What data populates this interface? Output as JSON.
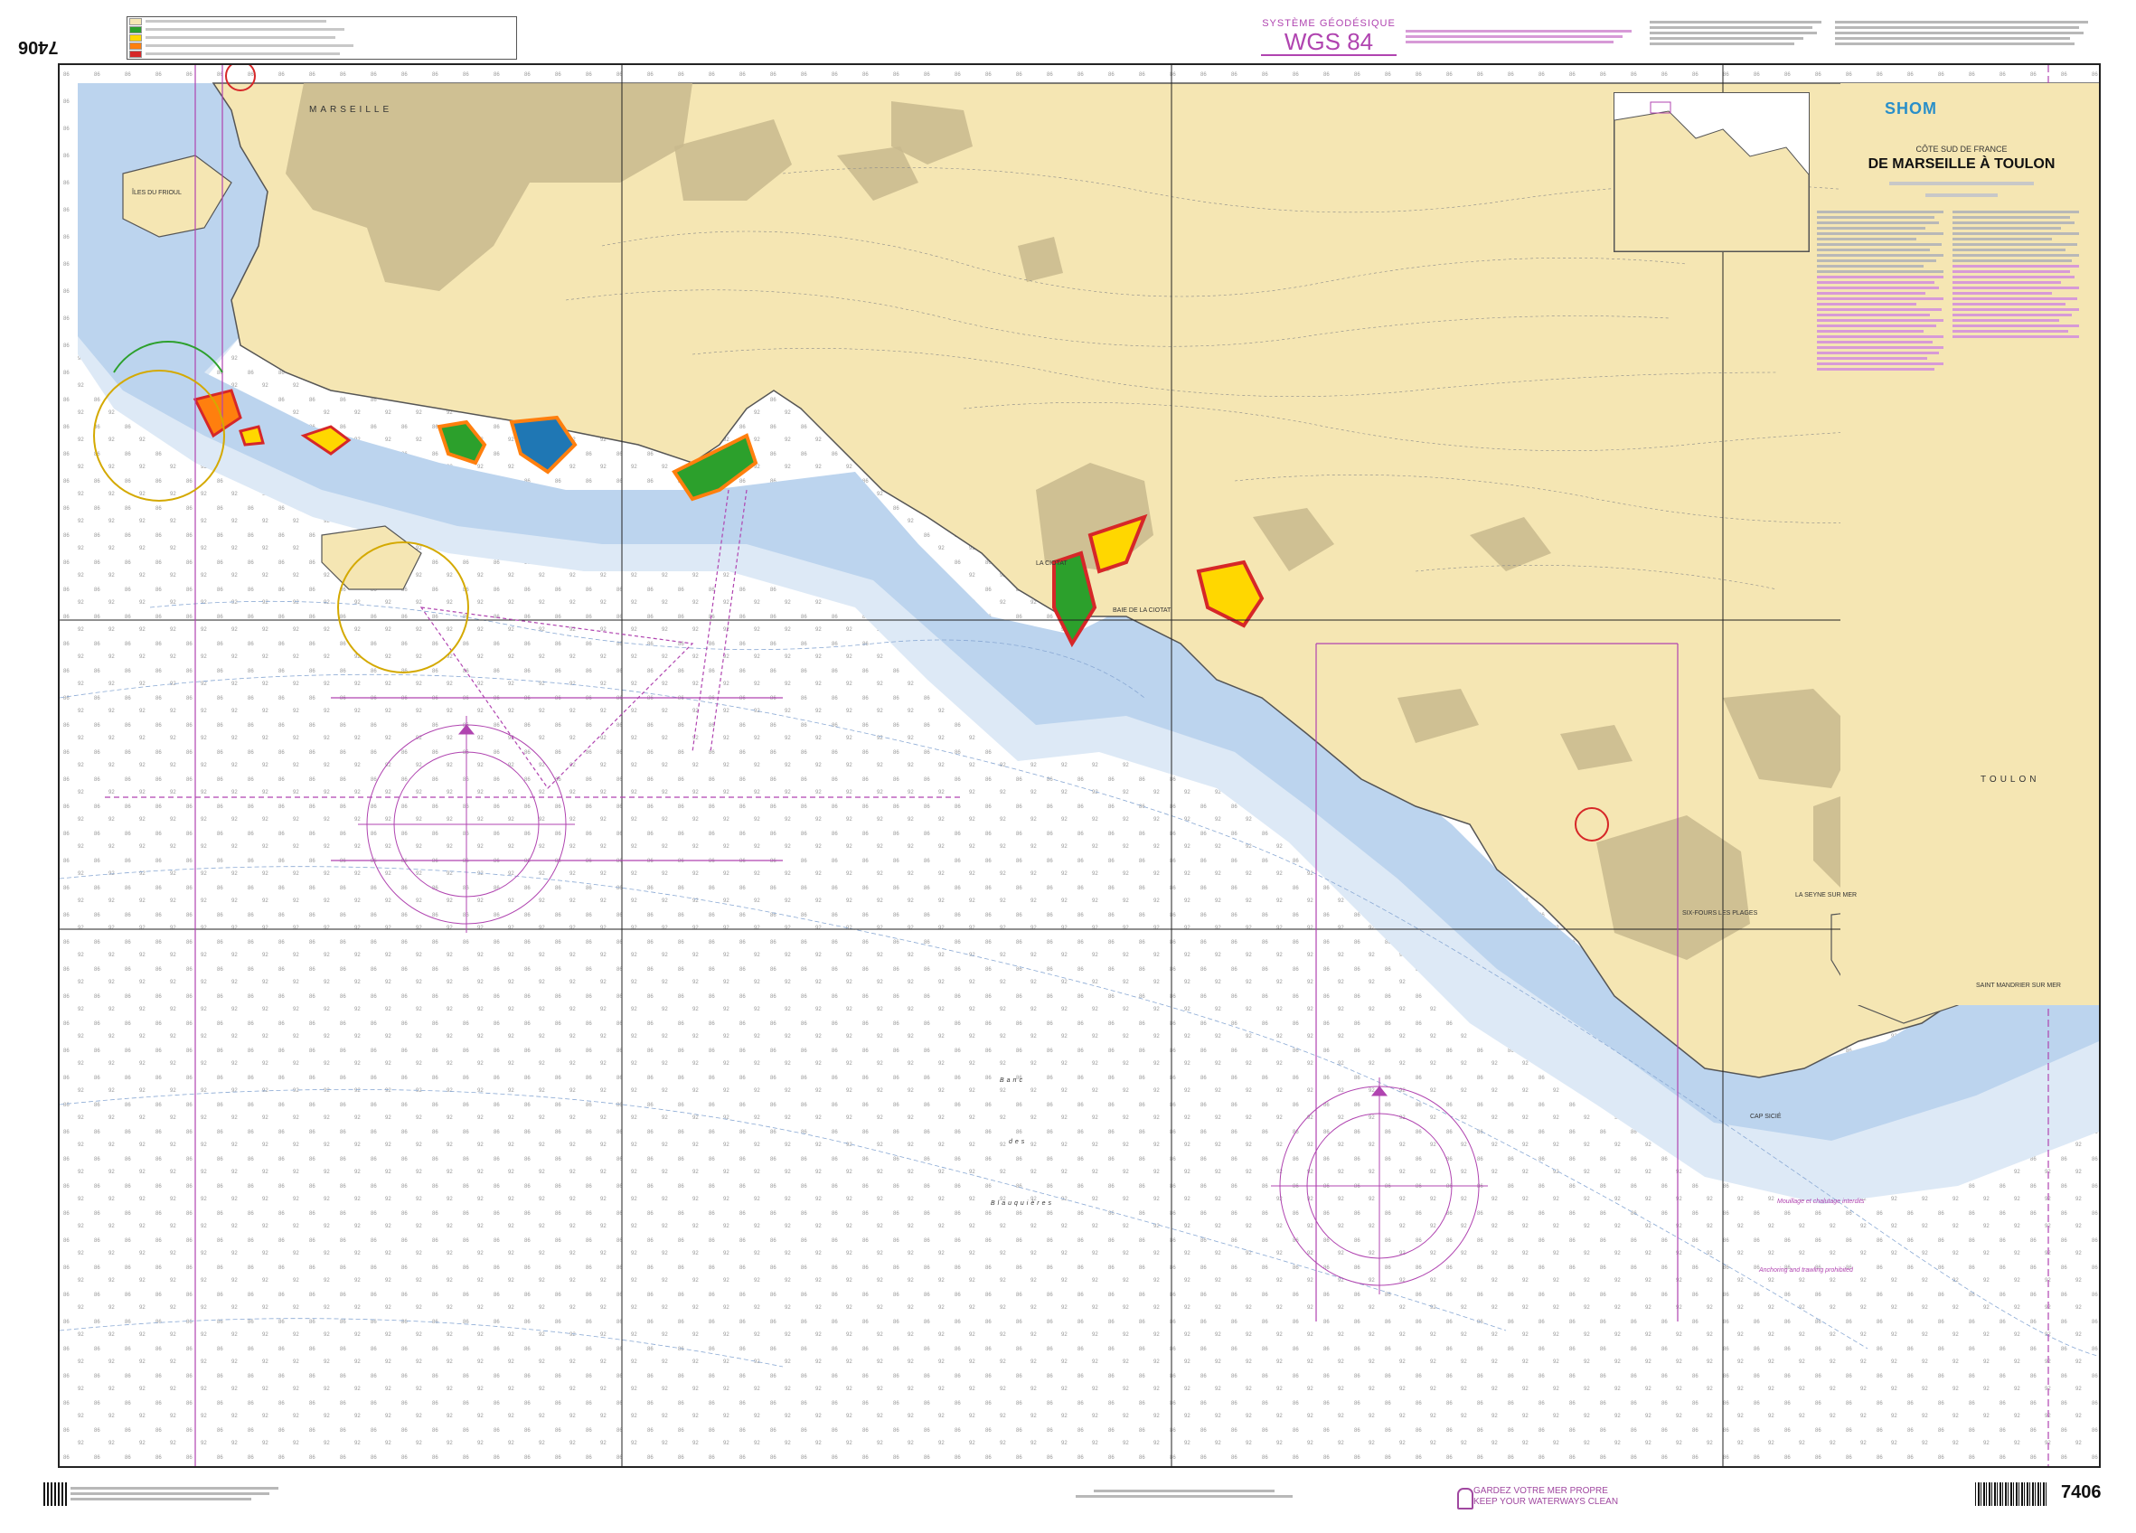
{
  "chart_number": "7406",
  "chart_number_rotated": "7406",
  "geodesic": {
    "label": "SYSTÈME GÉODÉSIQUE",
    "value": "WGS 84"
  },
  "shom": {
    "logo": "SHOM"
  },
  "title": {
    "region": "CÔTE SUD DE FRANCE",
    "main": "DE MARSEILLE À TOULON"
  },
  "places": {
    "marseille": "MARSEILLE",
    "toulon": "TOULON",
    "la_ciotat": "LA CIOTAT",
    "banc": "Banc",
    "des": "des",
    "blauquieres": "Blauquières",
    "iles_du_frioul": "ÎLES DU FRIOUL",
    "la_seyne": "LA SEYNE SUR MER",
    "six_fours": "SIX-FOURS LES PLAGES",
    "saint_mandrier": "SAINT MANDRIER SUR MER",
    "cap_sicie": "CAP SICIÉ",
    "baie_ciotat": "BAIE DE LA CIOTAT"
  },
  "annotations": {
    "mouillage": "Mouillage et chalutage interdits",
    "ancrage": "Anchoring and trawling prohibited"
  },
  "footer": {
    "clean_sea_fr": "GARDEZ VOTRE MER PROPRE",
    "clean_sea_en": "KEEP YOUR WATERWAYS CLEAN"
  },
  "colors": {
    "land": "#f5e6b3",
    "urban": "#c8b98d",
    "shallow": "#bcd4ee",
    "mid": "#dde9f6",
    "deep": "#ffffff",
    "magenta": "#b044b0",
    "coast": "#555555"
  },
  "icons": [
    "compass-rose-icon",
    "barcode-icon",
    "qr-code-icon",
    "clean-sea-icon"
  ]
}
